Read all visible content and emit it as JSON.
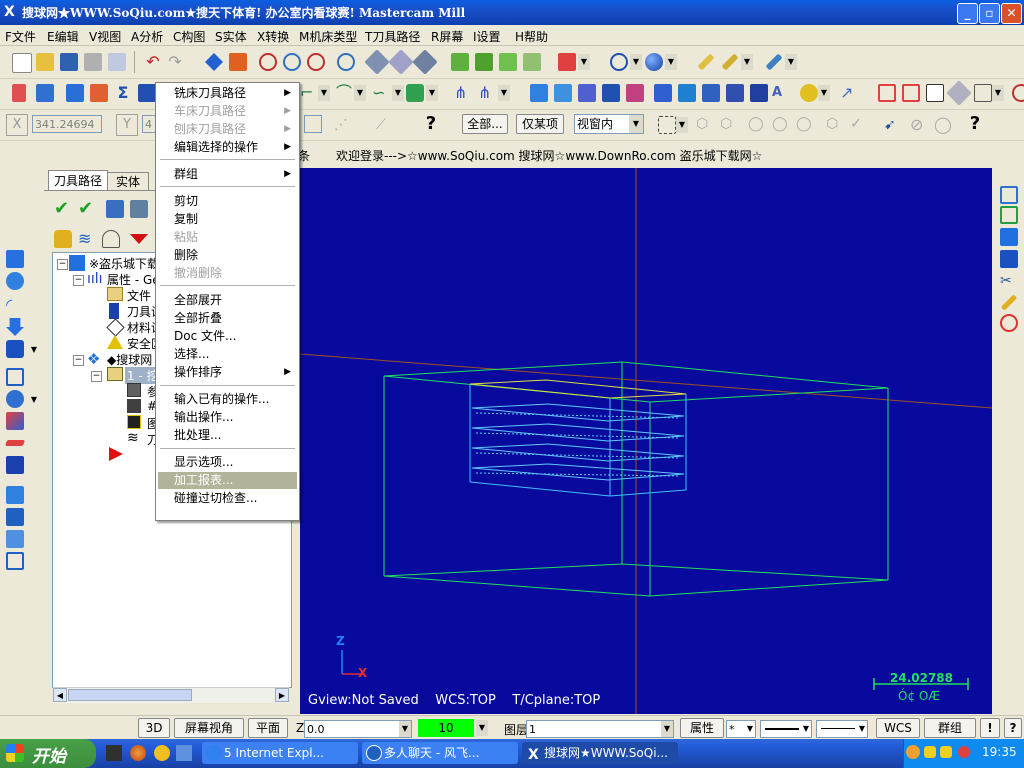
{
  "window": {
    "title": "搜球网★WWW.SoQiu.com★搜天下体育! 办公室内看球赛! Mastercam Mill",
    "controls": {
      "minimize": "_",
      "maximize": "▫",
      "close": "✕"
    }
  },
  "menubar": [
    "F文件",
    "E编辑",
    "V视图",
    "A分析",
    "C构图",
    "S实体",
    "X转换",
    "M机床类型",
    "T刀具路径",
    "R屏幕",
    "I设置",
    "H帮助"
  ],
  "coord_bar": {
    "x_label": "X",
    "x_value": "341.24694",
    "y_label": "Y",
    "y_value": "4",
    "all_button": "全部...",
    "only_button": "仅某项",
    "window_select": "视窗内",
    "help": "?"
  },
  "welcome_text": "欢迎登录--->☆www.SoQiu.com 搜球网☆www.DownRo.com 盗乐城下载网☆",
  "welcome_prefix": "条",
  "left_panel": {
    "tabs": [
      "刀具路径",
      "实体"
    ],
    "tree": [
      {
        "label": "※盗乐城下载",
        "icon": "machine-group-icon",
        "level": 0
      },
      {
        "label": "属性 - Ge",
        "icon": "properties-icon",
        "level": 1
      },
      {
        "label": "文件",
        "icon": "folder-icon",
        "level": 2
      },
      {
        "label": "刀具设",
        "icon": "tool-icon",
        "level": 2
      },
      {
        "label": "材料设",
        "icon": "material-icon",
        "level": 2
      },
      {
        "label": "安全区",
        "icon": "warning-icon",
        "level": 2
      },
      {
        "label": "◆搜球网",
        "icon": "toolpath-group-icon",
        "level": 1
      },
      {
        "label": "1 - 挖",
        "icon": "operation-folder-icon",
        "level": 2
      },
      {
        "label": "参",
        "icon": "parameters-icon",
        "level": 3
      },
      {
        "label": "#",
        "icon": "tool-number-icon",
        "level": 3
      },
      {
        "label": "图",
        "icon": "geometry-icon",
        "level": 3
      },
      {
        "label": "刀",
        "icon": "toolpath-icon",
        "level": 3
      }
    ]
  },
  "context_menu": {
    "items": [
      {
        "label": "铣床刀具路径",
        "submenu": true,
        "disabled": false
      },
      {
        "label": "车床刀具路径",
        "submenu": true,
        "disabled": true
      },
      {
        "label": "刨床刀具路径",
        "submenu": true,
        "disabled": true
      },
      {
        "label": "编辑选择的操作",
        "submenu": true,
        "disabled": false
      },
      {
        "sep": true
      },
      {
        "label": "群组",
        "submenu": true,
        "disabled": false
      },
      {
        "sep": true
      },
      {
        "label": "剪切",
        "disabled": false
      },
      {
        "label": "复制",
        "disabled": false
      },
      {
        "label": "粘贴",
        "disabled": true
      },
      {
        "label": "删除",
        "disabled": false
      },
      {
        "label": "撤消删除",
        "disabled": true
      },
      {
        "sep": true
      },
      {
        "label": "全部展开",
        "disabled": false
      },
      {
        "label": "全部折叠",
        "disabled": false
      },
      {
        "label": "Doc 文件...",
        "disabled": false
      },
      {
        "label": "选择...",
        "disabled": false
      },
      {
        "label": "操作排序",
        "submenu": true,
        "disabled": false
      },
      {
        "sep": true
      },
      {
        "label": "输入已有的操作...",
        "disabled": false
      },
      {
        "label": "输出操作...",
        "disabled": false
      },
      {
        "label": "批处理...",
        "disabled": false
      },
      {
        "sep": true
      },
      {
        "label": "显示选项...",
        "disabled": false
      },
      {
        "label": "加工报表...",
        "disabled": false,
        "highlighted": true
      },
      {
        "label": "碰撞过切检查...",
        "disabled": false
      }
    ]
  },
  "viewport": {
    "background": "#070a9c",
    "status_text": "Gview:Not Saved    WCS:TOP    T/Cplane:TOP",
    "scale_value": "24.02788",
    "scale_unit": "Ó¢ OÆ",
    "axis_z": "Z",
    "axis_x": "X"
  },
  "statusbar": {
    "btn_3d": "3D",
    "btn_view": "屏幕视角",
    "btn_plane": "平面",
    "z_label": "Z",
    "z_value": "0.0",
    "color_value": "10",
    "color_swatch": "#00ff00",
    "level_label": "图层",
    "level_value": "1",
    "attr": "属性",
    "point_style": "*",
    "wcs": "WCS",
    "group": "群组",
    "help": "!",
    "help2": "?"
  },
  "taskbar": {
    "start": "开始",
    "tasks": [
      "5 Internet Expl...",
      "多人聊天 - 风飞...",
      "搜球网★WWW.SoQi..."
    ],
    "time": "19:35"
  }
}
